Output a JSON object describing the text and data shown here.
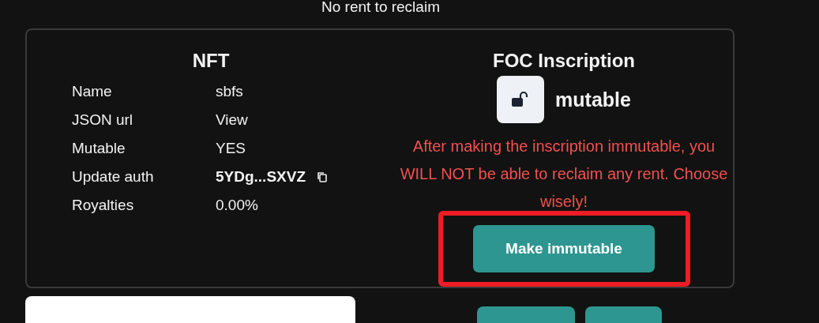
{
  "rent_status": "No rent to reclaim",
  "nft": {
    "title": "NFT",
    "rows": [
      {
        "label": "Name",
        "value": "sbfs",
        "kind": "text"
      },
      {
        "label": "JSON url",
        "value": "View",
        "kind": "link"
      },
      {
        "label": "Mutable",
        "value": "YES",
        "kind": "text"
      },
      {
        "label": "Update auth",
        "value": "5YDg...SXVZ",
        "kind": "address"
      },
      {
        "label": "Royalties",
        "value": "0.00%",
        "kind": "text"
      }
    ]
  },
  "inscription": {
    "title": "FOC Inscription",
    "mutable": true,
    "status": "mutable",
    "warning": "After making the inscription immutable, you WILL NOT be able to reclaim any rent. Choose wisely!",
    "button": "Make immutable",
    "highlighted": true
  }
}
